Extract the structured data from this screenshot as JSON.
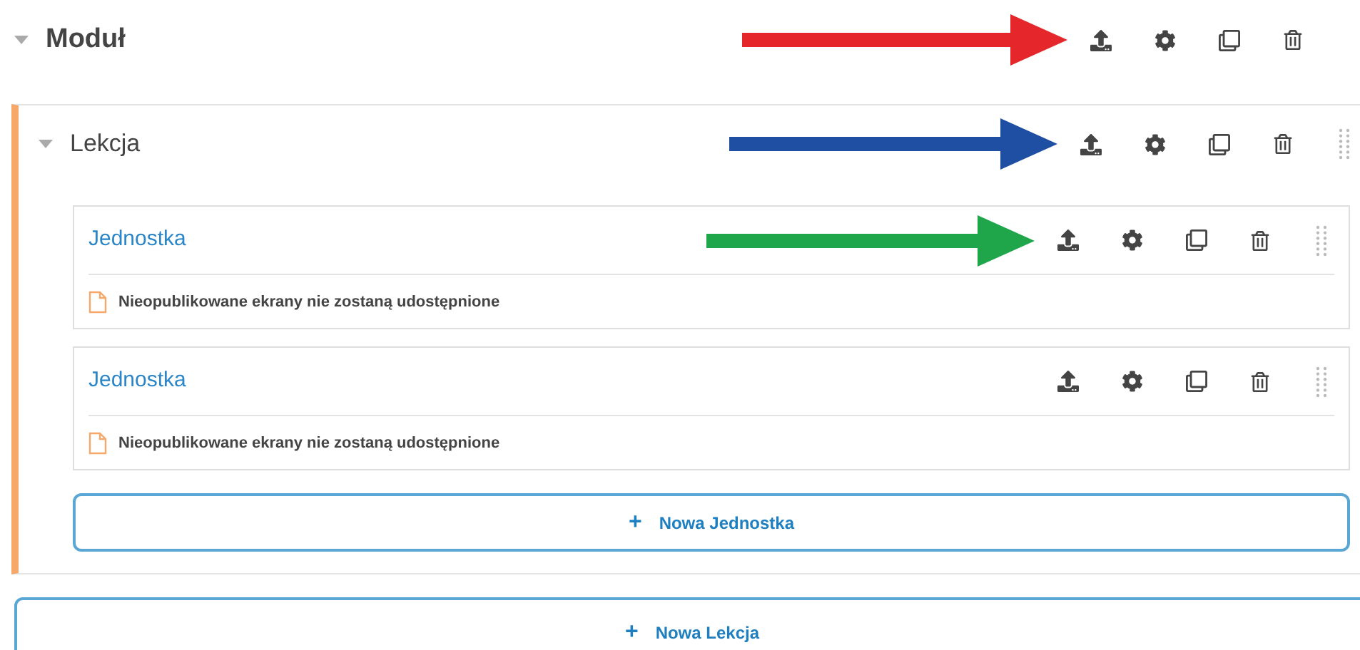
{
  "module": {
    "title": "Moduł",
    "expanded": true,
    "arrow": {
      "color": "#e5262b"
    },
    "lesson": {
      "title": "Lekcja",
      "expanded": true,
      "arrow": {
        "color": "#1f4fa3"
      },
      "units": [
        {
          "title": "Jednostka",
          "notice": "Nieopublikowane ekrany nie zostaną udostępnione",
          "arrow": {
            "color": "#1fa64a"
          }
        },
        {
          "title": "Jednostka",
          "notice": "Nieopublikowane ekrany nie zostaną udostępnione"
        }
      ],
      "add_button": {
        "icon": "+",
        "label": "Nowa Jednostka"
      }
    },
    "add_button": {
      "icon": "+",
      "label": "Nowa Lekcja"
    }
  }
}
